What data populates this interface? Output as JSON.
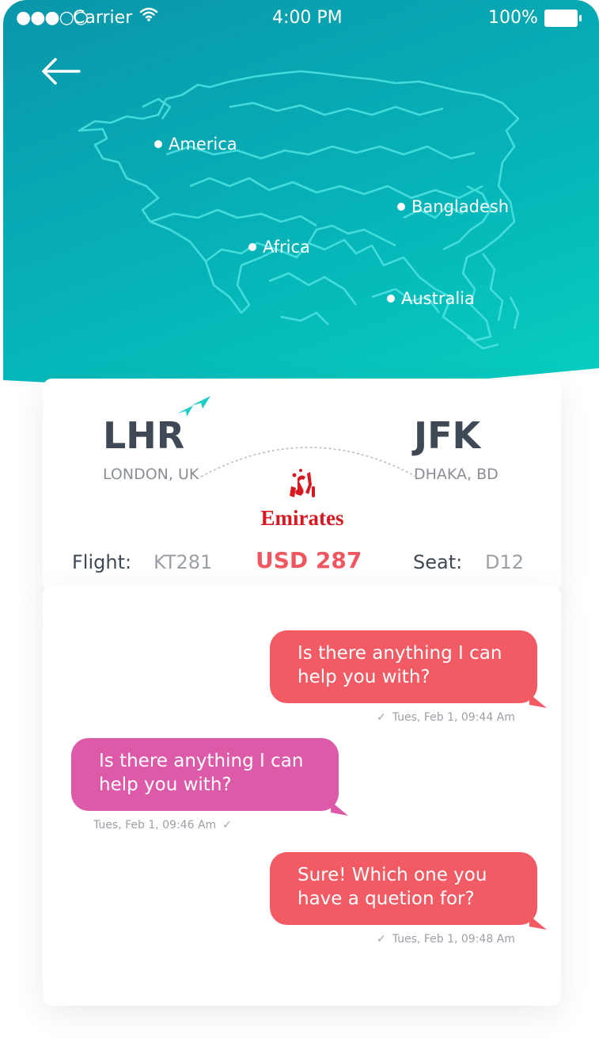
{
  "status_bar": {
    "signal": "●●●○○",
    "carrier": "Carrier",
    "time": "4:00 PM",
    "battery_percent": "100%"
  },
  "map": {
    "cities": [
      "America",
      "Bangladesh",
      "Africa",
      "Australia"
    ]
  },
  "flight": {
    "origin_code": "LHR",
    "origin_city": "LONDON, UK",
    "destination_code": "JFK",
    "destination_city": "DHAKA, BD",
    "airline": "Emirates",
    "flight_label": "Flight:",
    "flight_number": "KT281",
    "price": "USD 287",
    "seat_label": "Seat:",
    "seat": "D12"
  },
  "chat": {
    "messages": [
      {
        "line1": "Is there anything I can",
        "line2": "help you with?",
        "time": "Tues, Feb 1, 09:44 Am",
        "side": "right"
      },
      {
        "line1": "Is there anything I can",
        "line2": "help you with?",
        "time": "Tues, Feb 1, 09:46 Am",
        "side": "left"
      },
      {
        "line1": "Sure! Which one you",
        "line2": "have a quetion for?",
        "time": "Tues, Feb 1, 09:48 Am",
        "side": "right"
      }
    ]
  },
  "colors": {
    "header_start": "#0a96aa",
    "header_end": "#07cfc0",
    "accent_red": "#f25a64",
    "accent_pink": "#dd5aa8",
    "text_dark": "#3f4955"
  }
}
